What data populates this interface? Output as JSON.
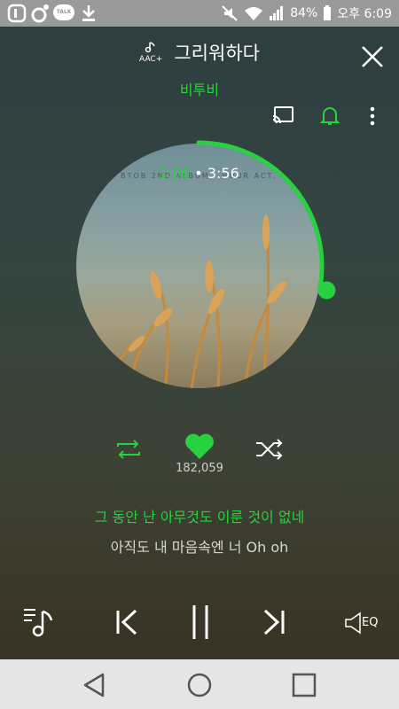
{
  "status_bar": {
    "battery": "84%",
    "time": "오후 6:09",
    "talk_label": "TALK",
    "icons": [
      "app-icon",
      "music-icon",
      "talk-icon",
      "download-icon",
      "mute-icon",
      "wifi-icon",
      "signal-icon",
      "battery-icon"
    ]
  },
  "header": {
    "codec_label": "AAC+",
    "title": "그리워하다",
    "artist": "비투비"
  },
  "album": {
    "cover_text": "BTOB 2ND ALBUM · HOUR ACT.",
    "current_time": "1:06",
    "total_time": "3:56",
    "progress": 0.28
  },
  "actions": {
    "likes": "182,059"
  },
  "lyrics": {
    "current": "그 동안 난 아무것도 이룬 것이 없네",
    "next": "아직도 내 마음속엔 너 Oh oh"
  },
  "player": {
    "eq_label": "EQ"
  },
  "colors": {
    "accent": "#27d13f"
  }
}
